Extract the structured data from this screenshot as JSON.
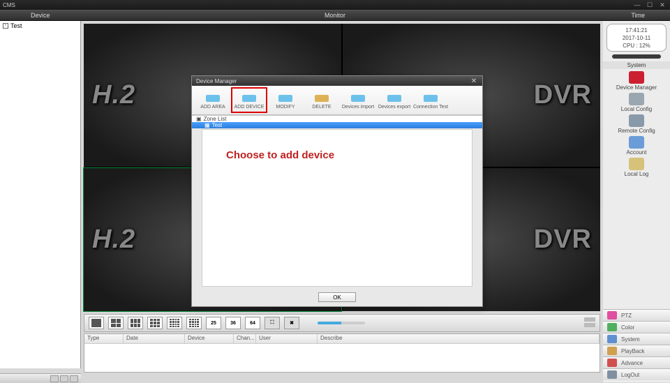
{
  "app": {
    "title": "CMS"
  },
  "topbar": {
    "device": "Device",
    "monitor": "Monitor",
    "time": "Time"
  },
  "tree": {
    "root": "Test"
  },
  "timebox": {
    "clock": "17:41:21",
    "date": "2017-10-11",
    "cpu": "CPU : 12%"
  },
  "system": {
    "header": "System",
    "items": [
      {
        "label": "Device Manager",
        "color": "#cc2030"
      },
      {
        "label": "Local Config",
        "color": "#9aa6b0"
      },
      {
        "label": "Remote Config",
        "color": "#8899aa"
      },
      {
        "label": "Account",
        "color": "#6a9dd8"
      },
      {
        "label": "Local Log",
        "color": "#d7c27a"
      }
    ]
  },
  "toolbar": {
    "n25": "25",
    "n36": "36",
    "n64": "64"
  },
  "table": {
    "cols": [
      "Type",
      "Date",
      "Device",
      "Chan...",
      "User",
      "Describe"
    ]
  },
  "right_tabs": [
    {
      "label": "PTZ",
      "color": "#e050a0"
    },
    {
      "label": "Color",
      "color": "#50b060"
    },
    {
      "label": "System",
      "color": "#6090d0"
    },
    {
      "label": "PlayBack",
      "color": "#d0a050"
    },
    {
      "label": "Advance",
      "color": "#d05050"
    },
    {
      "label": "LogOut",
      "color": "#8090a0"
    }
  ],
  "cells": {
    "logo_left": "H.2",
    "logo_right": "DVR"
  },
  "modal": {
    "title": "Device Manager",
    "buttons": [
      {
        "label": "ADD AREA"
      },
      {
        "label": "ADD DEVICE",
        "highlighted": true
      },
      {
        "label": "MODIFY"
      },
      {
        "label": "DELETE"
      },
      {
        "label": "Devices import"
      },
      {
        "label": "Devices export"
      },
      {
        "label": "Connection Test"
      }
    ],
    "tree": {
      "root": "Zone List",
      "child": "Test"
    },
    "hint": "Choose to add device",
    "ok": "OK"
  }
}
